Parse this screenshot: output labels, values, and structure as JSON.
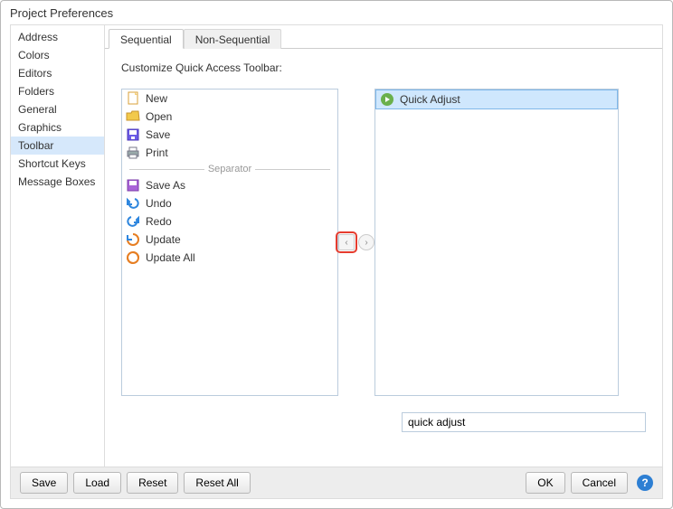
{
  "title": "Project Preferences",
  "sidebar": {
    "items": [
      {
        "label": "Address"
      },
      {
        "label": "Colors"
      },
      {
        "label": "Editors"
      },
      {
        "label": "Folders"
      },
      {
        "label": "General"
      },
      {
        "label": "Graphics"
      },
      {
        "label": "Toolbar"
      },
      {
        "label": "Shortcut Keys"
      },
      {
        "label": "Message Boxes"
      }
    ],
    "selected": 6
  },
  "tabs": {
    "items": [
      {
        "label": "Sequential"
      },
      {
        "label": "Non-Sequential"
      }
    ],
    "active": 0
  },
  "customize_label": "Customize Quick Access Toolbar:",
  "left_list": [
    {
      "label": "New",
      "icon": "new"
    },
    {
      "label": "Open",
      "icon": "open"
    },
    {
      "label": "Save",
      "icon": "save"
    },
    {
      "label": "Print",
      "icon": "print"
    },
    {
      "separator": true,
      "label": "Separator"
    },
    {
      "label": "Save As",
      "icon": "saveas"
    },
    {
      "label": "Undo",
      "icon": "undo"
    },
    {
      "label": "Redo",
      "icon": "redo"
    },
    {
      "label": "Update",
      "icon": "update"
    },
    {
      "label": "Update All",
      "icon": "updateall"
    }
  ],
  "right_list": [
    {
      "label": "Quick Adjust",
      "icon": "quickadjust",
      "selected": true
    }
  ],
  "text_input": "quick adjust",
  "buttons": {
    "save": "Save",
    "load": "Load",
    "reset": "Reset",
    "reset_all": "Reset All",
    "ok": "OK",
    "cancel": "Cancel"
  }
}
